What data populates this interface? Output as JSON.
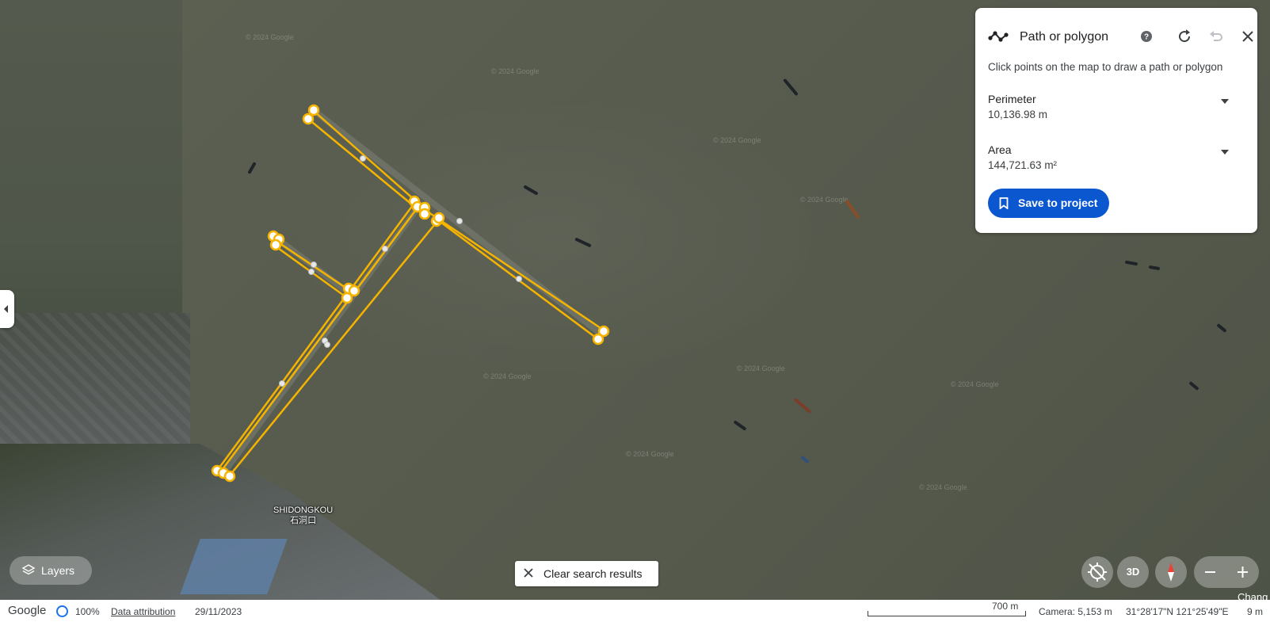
{
  "map": {
    "place_label": {
      "latin": "SHIDONGKOU",
      "chinese": "石洞口"
    },
    "watermark_text": "© 2024 Google",
    "edge_text": "Chang"
  },
  "panel": {
    "title": "Path or polygon",
    "description": "Click points on the map to draw a path or polygon",
    "icons": [
      "path-icon",
      "help-icon",
      "refresh-icon",
      "undo-icon",
      "close-icon"
    ],
    "perimeter": {
      "label": "Perimeter",
      "value": "10,136.98 m"
    },
    "area": {
      "label": "Area",
      "value": "144,721.63 m²"
    },
    "save_label": "Save to project"
  },
  "controls": {
    "layers_label": "Layers",
    "clear_label": "Clear search results",
    "btn_3d": "3D"
  },
  "statusbar": {
    "logo": "Google",
    "zoom_pct": "100%",
    "attribution": "Data attribution",
    "date": "29/11/2023",
    "scale": "700 m",
    "camera": "Camera: 5,153 m",
    "coords": "31°28'17\"N 121°25'49\"E",
    "elevation": "9 m"
  },
  "colors": {
    "path_stroke": "#f4b400",
    "accent_blue": "#0b57d0"
  }
}
